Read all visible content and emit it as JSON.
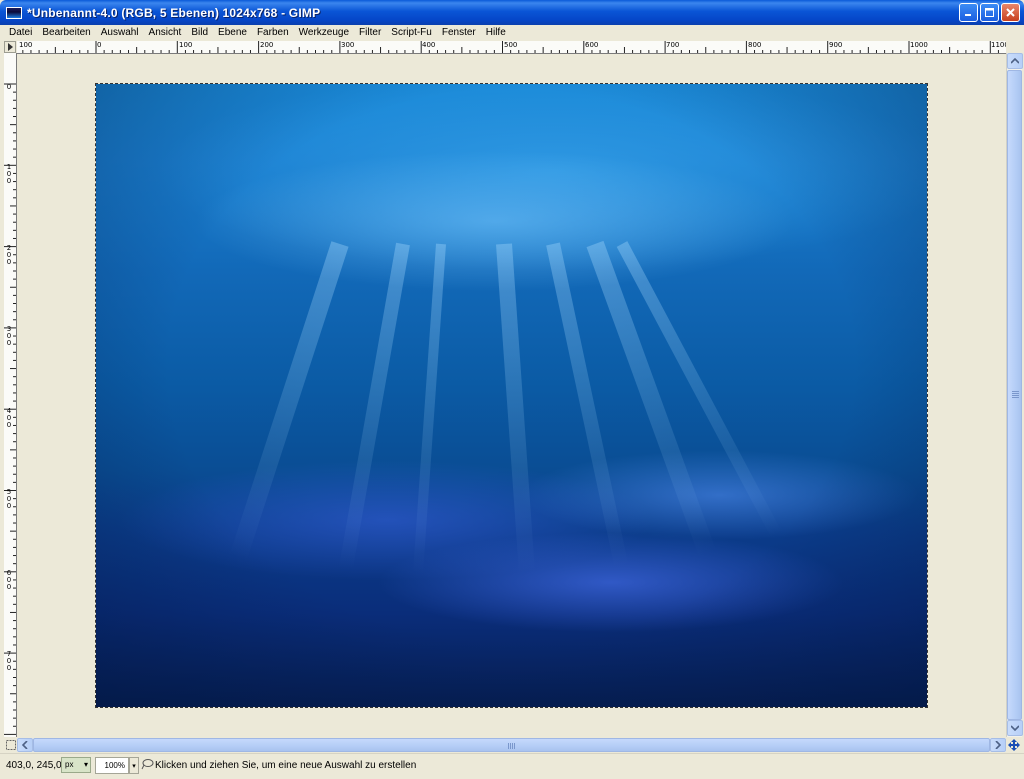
{
  "window": {
    "title": "*Unbenannt-4.0 (RGB, 5 Ebenen) 1024x768 - GIMP",
    "minimize_icon": "minimize-icon",
    "maximize_icon": "maximize-icon",
    "close_icon": "close-icon"
  },
  "menu": {
    "items": [
      "Datei",
      "Bearbeiten",
      "Auswahl",
      "Ansicht",
      "Bild",
      "Ebene",
      "Farben",
      "Werkzeuge",
      "Filter",
      "Script-Fu",
      "Fenster",
      "Hilfe"
    ]
  },
  "ruler_h": {
    "labels": [
      "100",
      "0",
      "100",
      "200",
      "300",
      "400",
      "500",
      "600",
      "700",
      "800",
      "900",
      "1000",
      "1100"
    ]
  },
  "ruler_v": {
    "labels": [
      "0",
      "100",
      "200",
      "300",
      "400",
      "500",
      "600",
      "700"
    ]
  },
  "statusbar": {
    "coords": "403,0, 245,0",
    "unit": "px",
    "zoom": "100%",
    "hint": "Klicken und ziehen Sie, um eine neue Auswahl zu erstellen"
  },
  "colors": {
    "titlebar": "#0a55d6",
    "chrome": "#ece9d8",
    "water_top": "#1a8ad8",
    "water_bottom": "#061e52"
  }
}
